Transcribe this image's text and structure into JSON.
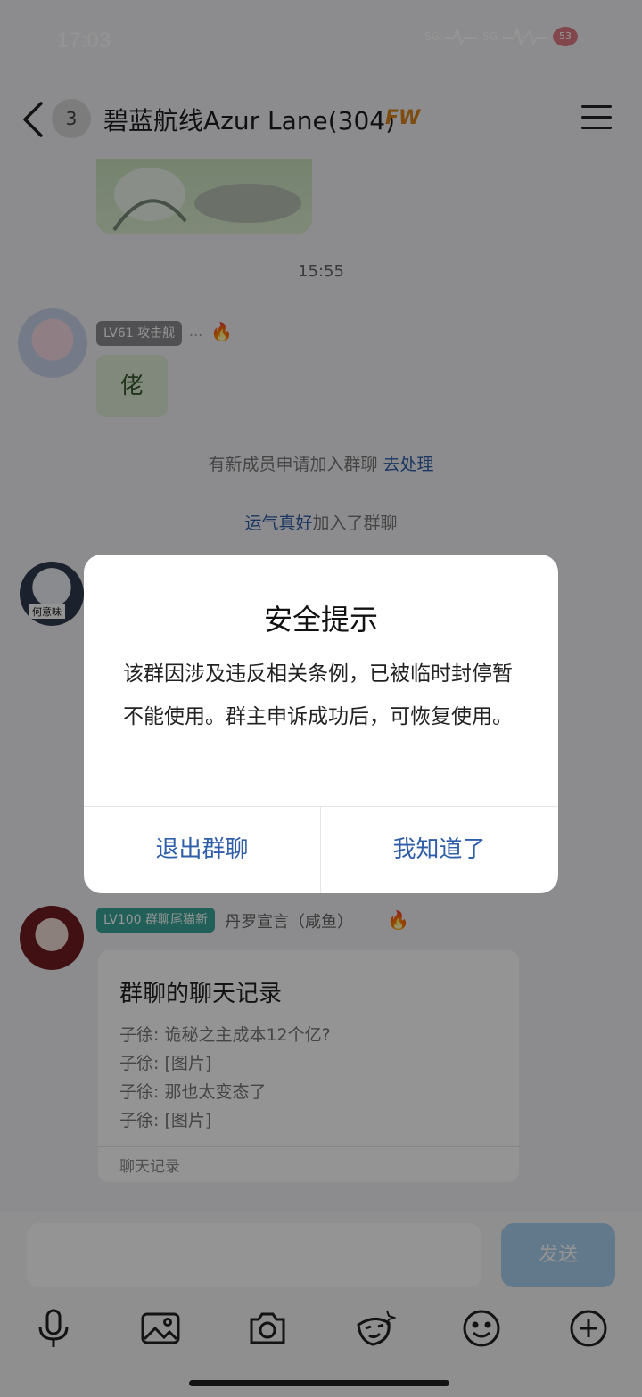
{
  "status_bar": {
    "time": "17:03",
    "network_1": "5G",
    "network_2": "5G",
    "battery": "53"
  },
  "header": {
    "unread_count": "3",
    "title": "碧蓝航线Azur Lane(304)",
    "title_tag": "FW"
  },
  "chat": {
    "time_label": "15:55",
    "msg1": {
      "level_badge": "LV61 攻击舰",
      "name_dots": "...",
      "sticker_text": "佬"
    },
    "system_msg_1": {
      "text": "有新成员申请加入群聊 ",
      "link": "去处理"
    },
    "system_msg_2": {
      "name": "运气真好",
      "text": "加入了群聊"
    },
    "msg2": {
      "avatar_label": "何意味"
    },
    "msg3": {
      "level_badge": "LV100 群聊尾猫新",
      "sender": "丹罗宣言（咸鱼）",
      "card": {
        "title": "群聊的聊天记录",
        "lines": [
          "子徐: 诡秘之主成本12个亿?",
          "子徐: [图片]",
          "子徐: 那也太变态了",
          "子徐: [图片]"
        ],
        "footer": "聊天记录"
      }
    }
  },
  "input_bar": {
    "send_label": "发送"
  },
  "dialog": {
    "title": "安全提示",
    "body": "该群因涉及违反相关条例，已被临时封停暂不能使用。群主申诉成功后，可恢复使用。",
    "exit_label": "退出群聊",
    "ok_label": "我知道了"
  },
  "colors": {
    "accent": "#2f5ea8",
    "send_button": "#a9cff0",
    "overlay": "rgba(0,0,0,0.42)"
  },
  "icons": [
    "back-icon",
    "menu-icon",
    "microphone-icon",
    "image-icon",
    "camera-icon",
    "sticker-icon",
    "emoji-icon",
    "plus-icon",
    "flame-icon"
  ]
}
